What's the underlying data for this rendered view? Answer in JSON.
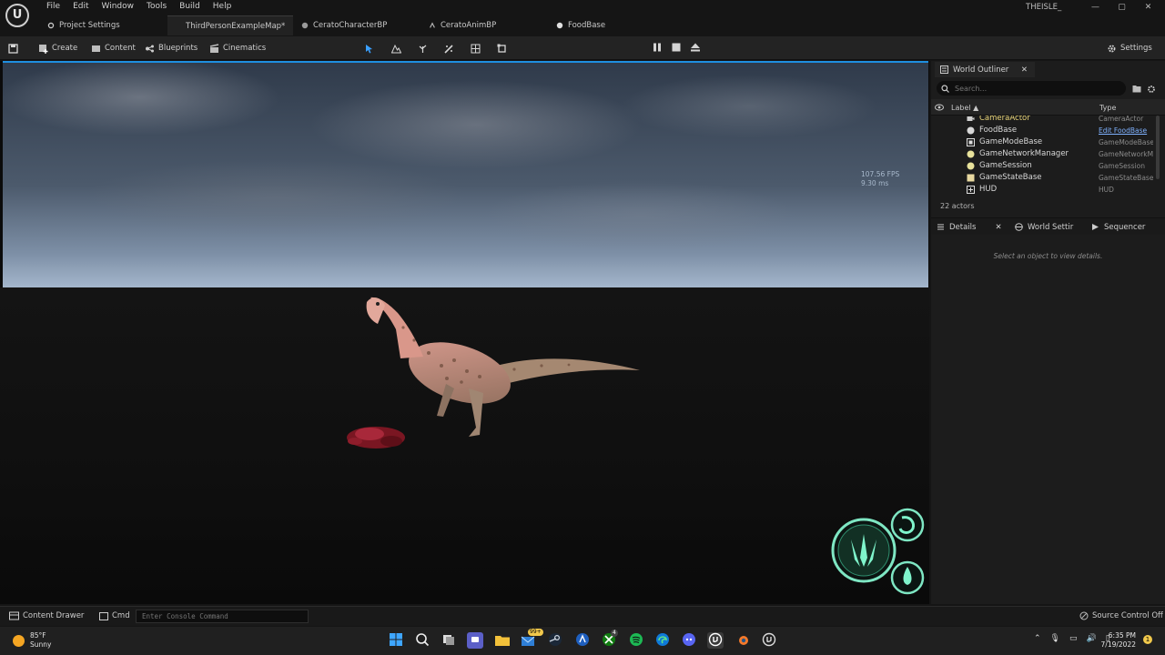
{
  "menu": [
    "File",
    "Edit",
    "Window",
    "Tools",
    "Build",
    "Help"
  ],
  "app": {
    "logo_text": "U",
    "user": "THEISLE_"
  },
  "window_controls": [
    "—",
    "▢",
    "✕"
  ],
  "tabs": [
    {
      "label": "Project Settings",
      "icon": "gear-icon"
    },
    {
      "label": "ThirdPersonExampleMap*",
      "icon": "map-icon"
    },
    {
      "label": "CeratoCharacterBP",
      "icon": "blueprint-icon"
    },
    {
      "label": "CeratoAnimBP",
      "icon": "animation-icon"
    },
    {
      "label": "FoodBase",
      "icon": "blueprint-icon"
    }
  ],
  "toolbar": {
    "save_icon": "save-icon",
    "create": "Create",
    "content": "Content",
    "blueprints": "Blueprints",
    "cinematics": "Cinematics",
    "settings": "Settings",
    "mode_icons": [
      "select-mode-icon",
      "landscape-icon",
      "foliage-icon",
      "mesh-paint-icon",
      "fracture-icon",
      "modeling-icon"
    ],
    "play_controls": [
      "pause-icon",
      "stop-icon",
      "eject-icon"
    ]
  },
  "viewport": {
    "fps": "107.56 FPS",
    "ms": "9.30 ms"
  },
  "outliner": {
    "tab_label": "World Outliner",
    "search_placeholder": "Search...",
    "col_label": "Label ▲",
    "col_type": "Type",
    "rows": [
      {
        "label": "CameraActor",
        "type": "CameraActor",
        "icon": "camera-icon",
        "link": false
      },
      {
        "label": "FoodBase",
        "type": "Edit FoodBase",
        "icon": "sphere-icon",
        "link": true
      },
      {
        "label": "GameModeBase",
        "type": "GameModeBase",
        "icon": "gamemode-icon",
        "link": false
      },
      {
        "label": "GameNetworkManager",
        "type": "GameNetworkM",
        "icon": "sphere-icon",
        "link": false
      },
      {
        "label": "GameSession",
        "type": "GameSession",
        "icon": "sphere-icon",
        "link": false
      },
      {
        "label": "GameStateBase",
        "type": "GameStateBase",
        "icon": "gamestate-icon",
        "link": false
      },
      {
        "label": "HUD",
        "type": "HUD",
        "icon": "hud-icon",
        "link": false
      }
    ],
    "actor_count": "22 actors"
  },
  "details": {
    "tabs": [
      {
        "label": "Details",
        "icon": "details-icon"
      },
      {
        "label": "World Settir",
        "icon": "world-settings-icon"
      },
      {
        "label": "Sequencer",
        "icon": "sequencer-icon"
      }
    ],
    "empty_text": "Select an object to view details."
  },
  "bottom": {
    "content_drawer": "Content Drawer",
    "cmd": "Cmd",
    "console_placeholder": "Enter Console Command",
    "source_control": "Source Control Off"
  },
  "taskbar": {
    "temp": "85°F",
    "condition": "Sunny",
    "time": "6:35 PM",
    "date": "7/19/2022",
    "mail_badge": "99+",
    "xbox_badge": "4",
    "notif": "1"
  },
  "colors": {
    "accent": "#1e8fe0",
    "link": "#7fb2ff",
    "hud_green": "#6ff0c0"
  }
}
